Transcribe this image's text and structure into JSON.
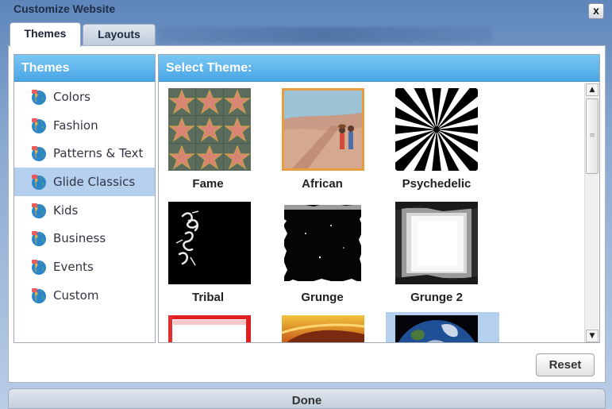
{
  "window": {
    "title": "Customize Website",
    "close_label": "x"
  },
  "tabs": [
    {
      "label": "Themes"
    },
    {
      "label": "Layouts"
    }
  ],
  "themes_panel": {
    "title": "Themes",
    "categories": [
      {
        "label": "Colors",
        "icon": "globe-icon"
      },
      {
        "label": "Fashion",
        "icon": "globe-icon"
      },
      {
        "label": "Patterns & Text",
        "icon": "globe-icon"
      },
      {
        "label": "Glide Classics",
        "icon": "globe-icon",
        "selected": true
      },
      {
        "label": "Kids",
        "icon": "globe-icon"
      },
      {
        "label": "Business",
        "icon": "globe-icon"
      },
      {
        "label": "Events",
        "icon": "globe-icon"
      },
      {
        "label": "Custom",
        "icon": "globe-icon"
      }
    ]
  },
  "select_panel": {
    "title": "Select Theme:",
    "themes": [
      {
        "label": "Fame"
      },
      {
        "label": "African"
      },
      {
        "label": "Psychedelic"
      },
      {
        "label": "Tribal"
      },
      {
        "label": "Grunge"
      },
      {
        "label": "Grunge 2"
      },
      {
        "label": ""
      },
      {
        "label": ""
      },
      {
        "label": ""
      }
    ]
  },
  "buttons": {
    "reset": "Reset",
    "done": "Done"
  },
  "colors": {
    "header_blue": "#49a6e6",
    "selected_bg": "#b4d0ee"
  }
}
